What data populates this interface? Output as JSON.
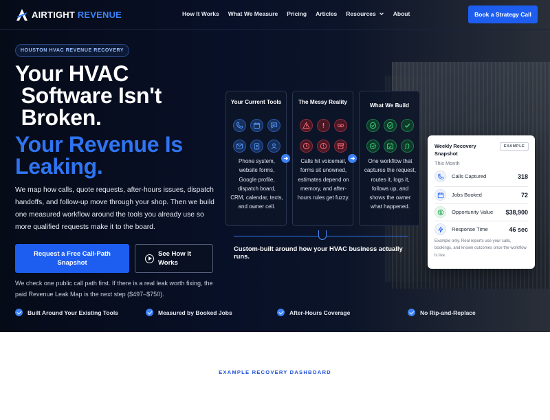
{
  "brand": {
    "name_main": "AIRTIGHT",
    "name_accent": "REVENUE"
  },
  "nav": {
    "links": [
      "How It Works",
      "What We Measure",
      "Pricing",
      "Articles",
      "Resources",
      "About"
    ],
    "cta": "Book a Strategy Call"
  },
  "hero": {
    "eyebrow": "HOUSTON HVAC REVENUE RECOVERY",
    "headline_white": [
      "Your HVAC",
      " Software Isn't",
      " Broken."
    ],
    "headline_blue": [
      "Your Revenue Is",
      "Leaking."
    ],
    "intro": "We map how calls, quote requests, after-hours issues, dispatch handoffs, and follow-up move through your shop. Then we build one measured workflow around the tools you already use so more qualified requests make it to the board.",
    "primary_cta": "Request a Free Call-Path Snapshot",
    "secondary_cta": "See How It Works",
    "note": "We check one public call path first. If there is a real leak worth fixing, the paid Revenue Leak Map is the next step ($497–$750).",
    "checks": [
      "Built Around Your Existing Tools",
      "Measured by Booked Jobs",
      "After-Hours Coverage",
      "No Rip-and-Replace"
    ]
  },
  "diagram": {
    "cards": [
      {
        "title": "Your Current Tools",
        "icons": [
          "phone-icon",
          "calendar-icon",
          "chat-icon",
          "mail-icon",
          "clipboard-icon",
          "user-icon"
        ],
        "color": "#3b82f6",
        "text": "Phone system, website forms, Google profile, dispatch board, CRM, calendar, texts, and owner cell."
      },
      {
        "title": "The Messy Reality",
        "icons": [
          "warning-icon",
          "exclamation-icon",
          "voicemail-icon",
          "clock-icon",
          "alert-circle-icon",
          "archive-icon"
        ],
        "color": "#ef4444",
        "text": "Calls hit voicemail, forms sit unowned, estimates depend on memory, and after-hours rules get fuzzy."
      },
      {
        "title": "What We Build",
        "icons": [
          "check-circle-icon",
          "check-circle-icon",
          "check-icon",
          "badge-check-icon",
          "calendar-check-icon",
          "route-icon"
        ],
        "color": "#22c55e",
        "text": "One workflow that captures the request, routes it, logs it, follows up, and shows the owner what happened."
      }
    ],
    "caption": "Custom-built around how your HVAC business actually runs."
  },
  "snapshot": {
    "title": "Weekly Recovery Snapshot",
    "badge": "EXAMPLE",
    "subtitle": "This Month",
    "rows": [
      {
        "label": "Calls Captured",
        "value": "318",
        "icon": "phone-icon"
      },
      {
        "label": "Jobs Booked",
        "value": "72",
        "icon": "calendar-icon"
      },
      {
        "label": "Opportunity Value",
        "value": "$38,900",
        "icon": "dollar-icon"
      },
      {
        "label": "Response Time",
        "value": "46 sec",
        "icon": "bolt-icon"
      }
    ],
    "note": "Example only. Real reports use your calls, bookings, and known outcomes once the workflow is live."
  },
  "section2": {
    "label": "EXAMPLE RECOVERY DASHBOARD"
  }
}
